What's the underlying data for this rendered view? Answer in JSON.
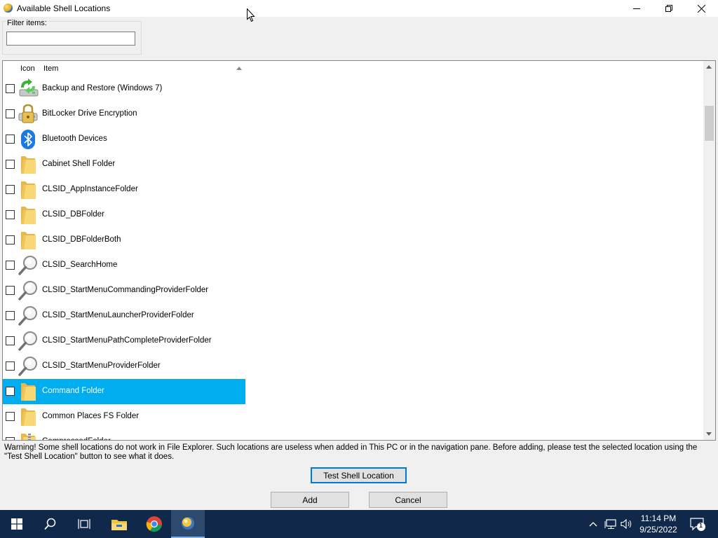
{
  "window": {
    "title": "Available Shell Locations"
  },
  "filter": {
    "label": "Filter items:",
    "value": "",
    "placeholder": ""
  },
  "list": {
    "columns": [
      "Icon",
      "Item"
    ],
    "rows": [
      {
        "label": "Backup and Restore (Windows 7)",
        "icon": "backup-restore-icon",
        "checked": false,
        "selected": false
      },
      {
        "label": "BitLocker Drive Encryption",
        "icon": "bitlocker-icon",
        "checked": false,
        "selected": false
      },
      {
        "label": "Bluetooth Devices",
        "icon": "bluetooth-icon",
        "checked": false,
        "selected": false
      },
      {
        "label": "Cabinet Shell Folder",
        "icon": "folder-icon",
        "checked": false,
        "selected": false
      },
      {
        "label": "CLSID_AppInstanceFolder",
        "icon": "folder-icon",
        "checked": false,
        "selected": false
      },
      {
        "label": "CLSID_DBFolder",
        "icon": "folder-icon",
        "checked": false,
        "selected": false
      },
      {
        "label": "CLSID_DBFolderBoth",
        "icon": "folder-icon",
        "checked": false,
        "selected": false
      },
      {
        "label": "CLSID_SearchHome",
        "icon": "search-icon",
        "checked": false,
        "selected": false
      },
      {
        "label": "CLSID_StartMenuCommandingProviderFolder",
        "icon": "search-icon",
        "checked": false,
        "selected": false
      },
      {
        "label": "CLSID_StartMenuLauncherProviderFolder",
        "icon": "search-icon",
        "checked": false,
        "selected": false
      },
      {
        "label": "CLSID_StartMenuPathCompleteProviderFolder",
        "icon": "search-icon",
        "checked": false,
        "selected": false
      },
      {
        "label": "CLSID_StartMenuProviderFolder",
        "icon": "search-icon",
        "checked": false,
        "selected": false
      },
      {
        "label": "Command Folder",
        "icon": "folder-icon",
        "checked": false,
        "selected": true
      },
      {
        "label": "Common Places FS Folder",
        "icon": "folder-icon",
        "checked": false,
        "selected": false
      },
      {
        "label": "CompressedFolder",
        "icon": "zip-folder-icon",
        "checked": false,
        "selected": false
      }
    ]
  },
  "warning": "Warning! Some shell locations do not work in File Explorer. Such locations are useless when added in This PC or in the navigation pane. Before adding, please test the selected location using the \"Test Shell Location\" button to see what it does.",
  "buttons": {
    "test": "Test Shell Location",
    "add": "Add",
    "cancel": "Cancel"
  },
  "taskbar": {
    "time": "11:14 PM",
    "date": "9/25/2022",
    "notifications": "1"
  },
  "colors": {
    "selection": "#00adef",
    "taskbar": "#10284a",
    "focus": "#0078d7"
  }
}
